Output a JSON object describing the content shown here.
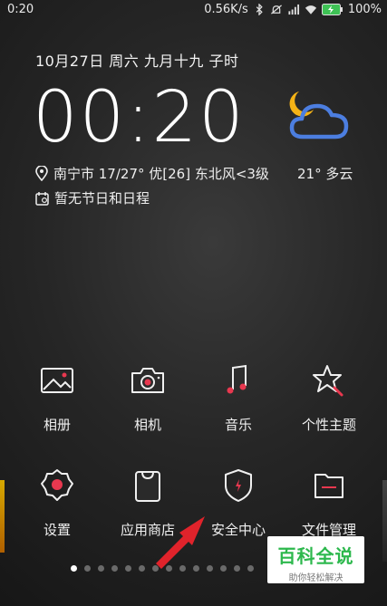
{
  "status_bar": {
    "time": "0:20",
    "speed": "0.56K/s",
    "battery": "100%",
    "icons": [
      "bluetooth-icon",
      "mute-icon",
      "signal-icon",
      "wifi-icon",
      "battery-charging-icon"
    ]
  },
  "lock": {
    "date": "10月27日  周六  九月十九  子时",
    "clock": "00:20",
    "location": "南宁市 17/27° 优[26] 东北风<3级",
    "temperature": "21° 多云",
    "calendar": "暂无节日和日程",
    "weather_icon": "cloudy-moon-icon"
  },
  "apps": [
    {
      "label": "相册",
      "icon": "gallery-icon"
    },
    {
      "label": "相机",
      "icon": "camera-icon"
    },
    {
      "label": "音乐",
      "icon": "music-icon"
    },
    {
      "label": "个性主题",
      "icon": "themes-icon"
    },
    {
      "label": "设置",
      "icon": "settings-icon"
    },
    {
      "label": "应用商店",
      "icon": "app-store-icon"
    },
    {
      "label": "安全中心",
      "icon": "security-icon"
    },
    {
      "label": "文件管理",
      "icon": "file-manager-icon"
    }
  ],
  "pager": {
    "pages": 14,
    "active_index": 0
  },
  "watermark": {
    "title": "百科全说",
    "subtitle": "助你轻松解决"
  },
  "colors": {
    "accent_red": "#e8384f",
    "weather_moon": "#f5b316",
    "weather_cloud": "#4c7ee0",
    "watermark_green": "#2db84d"
  }
}
